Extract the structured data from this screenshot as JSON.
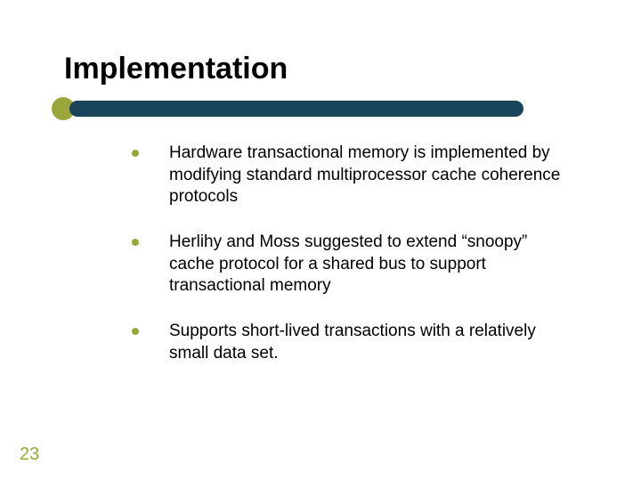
{
  "title": "Implementation",
  "bullets": [
    {
      "text": "Hardware transactional memory is implemented by modifying standard multiprocessor cache coherence protocols"
    },
    {
      "text": "Herlihy and Moss suggested to extend “snoopy” cache protocol for a shared bus to support transactional memory"
    },
    {
      "text": "Supports short-lived transactions with a relatively small data set."
    }
  ],
  "page_number": "23",
  "colors": {
    "accent_green": "#99a63a",
    "accent_blue": "#1a445b"
  }
}
